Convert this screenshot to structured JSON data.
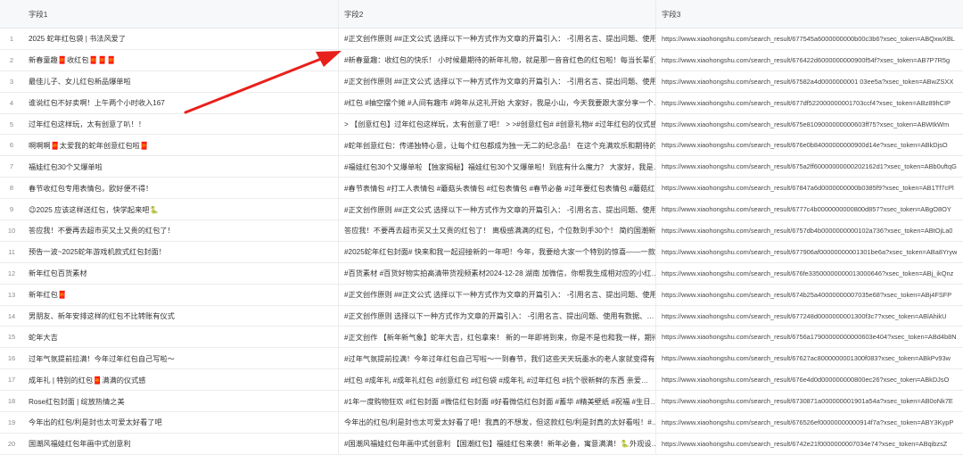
{
  "header": {
    "col1": "字段1",
    "col2": "字段2",
    "col3": "字段3"
  },
  "rows": [
    {
      "idx": "1",
      "c1": "2025 蛇年红包袋 | 书法风爱了",
      "c2": "#正文创作原则 ##正文公式 选择以下一种方式作为文章的开篇引入： -引用名言、提出问题、使用…",
      "c3": "https://www.xiaohongshu.com/search_result/677545a6000000000b00c3b6?xsec_token=ABQxwXBL"
    },
    {
      "idx": "2",
      "c1": "新春童趣🧧收红包🧧🧧🧧",
      "c2": "#新春童趣：收红包的快乐！ 小时候最期待的新年礼物，就是那一音音红色的红包啦！每当长辈们…",
      "c3": "https://www.xiaohongshu.com/search_result/676422d6000000000900f54f?xsec_token=AB7P7R5g"
    },
    {
      "idx": "3",
      "c1": "最佳儿子、女儿红包新品爆单啦",
      "c2": "#正文创作原则 ##正文公式 选择以下一种方式作为文章的开篇引入： -引用名言、提出问题、使用…",
      "c3": "https://www.xiaohongshu.com/search_result/67582a4d0000000001 03ee5a?xsec_token=ABwZSXX"
    },
    {
      "idx": "4",
      "c1": "谁说红包不好卖啊！上午两个小时收入167",
      "c2": "#红包 #抽空摆个摊 #人间有趣市 #跨年从这礼开始 大家好，我是小山，今天我要跟大家分享一个…",
      "c3": "https://www.xiaohongshu.com/search_result/677df522000000001703ccf4?xsec_token=ABz89hCIP"
    },
    {
      "idx": "5",
      "c1": "过年红包这样玩，太有创意了叭！！",
      "c2": "> 【创意红包】过年红包这样玩，太有创意了吧！ > >#创意红包# #创意礼物# #过年红包的仪式感…",
      "c3": "https://www.xiaohongshu.com/search_result/675e8109000000000603ff75?xsec_token=ABWtkWm"
    },
    {
      "idx": "6",
      "c1": "啊啊啊🧧太爱我的蛇年创意红包啦🧧",
      "c2": "#蛇年创意红包：传递独特心意，让每个红包都成为独一无二的纪念品！ 在这个充满欢乐和期待的…",
      "c3": "https://www.xiaohongshu.com/search_result/676e0b84000000000900d14e?xsec_token=ABkDjsO"
    },
    {
      "idx": "7",
      "c1": "福娃红包30个又爆单啦",
      "c2": "#福娃红包30个又爆单啦 【独家揭秘】福娃红包30个又爆单啦！到底有什么魔力？ 大家好，我是…",
      "c3": "https://www.xiaohongshu.com/search_result/675a2ff60000000000202162d1?xsec_token=ABb0uftqG"
    },
    {
      "idx": "8",
      "c1": "春节收红包专用表情包，欧好便不得！",
      "c2": "#春节表情包 #打工人表情包 #蘑菇头表情包 #红包表情包 #春节必备 #过年要红包表情包 #蘑菇红…",
      "c3": "https://www.xiaohongshu.com/search_result/67847a6d0000000000b0385f9?xsec_token=AB1Tf7cPl"
    },
    {
      "idx": "9",
      "c1": "😉2025 应该这样送红包，快学起来吧🐍",
      "c2": "#正文创作原则 ##正文公式 选择以下一种方式作为文章的开篇引入： -引用名言、提出问题、使用…",
      "c3": "https://www.xiaohongshu.com/search_result/6777c4b0000000000800d857?xsec_token=ABgO8OY"
    },
    {
      "idx": "10",
      "c1": "答应我！不要再去超市买又土又贵的红包了！",
      "c2": "答应我！不要再去超市买又土又贵的红包了！ 离极感满满的红包，个位数到手30个！ 简约国潮新…",
      "c3": "https://www.xiaohongshu.com/search_result/6757db4b0000000000102a736?xsec_token=ABtOjLa0"
    },
    {
      "idx": "11",
      "c1": "预告一波~2025蛇年游戏机款式红包封面！",
      "c2": "#2025蛇年红包封面# 快来和我一起迎接新的一年吧！今年，我要给大家一个特别的惊喜——一款…",
      "c3": "https://www.xiaohongshu.com/search_result/677906af00000000001301be6a?xsec_token=ABa8Yryw"
    },
    {
      "idx": "12",
      "c1": "新年红包百货素材",
      "c2": "#百货素材 #百货好物实拍高清带货视频素材2024-12-28 湖南 加微信，你帮我生成相对应的小红…",
      "c3": "https://www.xiaohongshu.com/search_result/676fe33500000000013000646?xsec_token=ABj_ikQnz"
    },
    {
      "idx": "13",
      "c1": "新年红包🧧",
      "c2": "#正文创作原则 ##正文公式 选择以下一种方式作为文章的开篇引入： -引用名言、提出问题、使用…",
      "c3": "https://www.xiaohongshu.com/search_result/674b25a40000000007035e68?xsec_token=ABj4FSFP"
    },
    {
      "idx": "14",
      "c1": "男朋友、新年安排这样的红包不比转账有仪式",
      "c2": "#正文创作原则 选择以下一种方式作为文章的开篇引入： -引用名言、提出问题、使用有数据、…",
      "c3": "https://www.xiaohongshu.com/search_result/677248d0000000001300f3c7?xsec_token=ABlAhikU"
    },
    {
      "idx": "15",
      "c1": "蛇年大吉",
      "c2": "#正文创作 【新年新气象】蛇年大吉，红包拿来！ 新的一年即将到来，你是不是也和我一样，期待…",
      "c3": "https://www.xiaohongshu.com/search_result/6756a17900000000000603e404?xsec_token=ABd4b8N"
    },
    {
      "idx": "16",
      "c1": "过年气氛提前拉满！今年过年红包自己写啦～",
      "c2": "#过年气氛提前拉满！今年过年红包自己写啦～一到春节，我们这些天天玩墨水的老人家就变得有…",
      "c3": "https://www.xiaohongshu.com/search_result/67627ac8000000001300f083?xsec_token=ABkPv93w"
    },
    {
      "idx": "17",
      "c1": "成年礼 | 特别的红包🧧满满的仪式感",
      "c2": "#红包 #成年礼 #成年礼红包 #创意红包 #红包袋 #成年礼 #过年红包 #抗个很新鲜的东西 亲爱…",
      "c3": "https://www.xiaohongshu.com/search_result/676e4d0d000000000800ec26?xsec_token=ABkDJsO"
    },
    {
      "idx": "18",
      "c1": "Rose红包封面 | 绽放热情之美",
      "c2": "#1年一度购物狂欢 #红包封面 #微信红包封面 #好看微信红包封面 #蓄华 #精美壁纸 #祝福 #生日…",
      "c3": "https://www.xiaohongshu.com/search_result/6730871a000000001901a54a?xsec_token=AB0oNk7E"
    },
    {
      "idx": "19",
      "c1": "今年出的红包/利是封也太可爱太好看了吧",
      "c2": "今年出的红包/利是封也太可爱太好看了吧！我真的不想发，但这款红包/利是封真的太好看啦！#…",
      "c3": "https://www.xiaohongshu.com/search_result/676526ef00000000000914f7a?xsec_token=ABY3KypP"
    },
    {
      "idx": "20",
      "c1": "国潮风福娃红包年画中式创意利",
      "c2": "#国潮风福娃红包年画中式创意利 【国潮红包】福娃红包来袭！新年必备，寓意满满！🐍外观设…",
      "c3": "https://www.xiaohongshu.com/search_result/6742e21f0000000007034e74?xsec_token=ABqibzsZ"
    }
  ]
}
